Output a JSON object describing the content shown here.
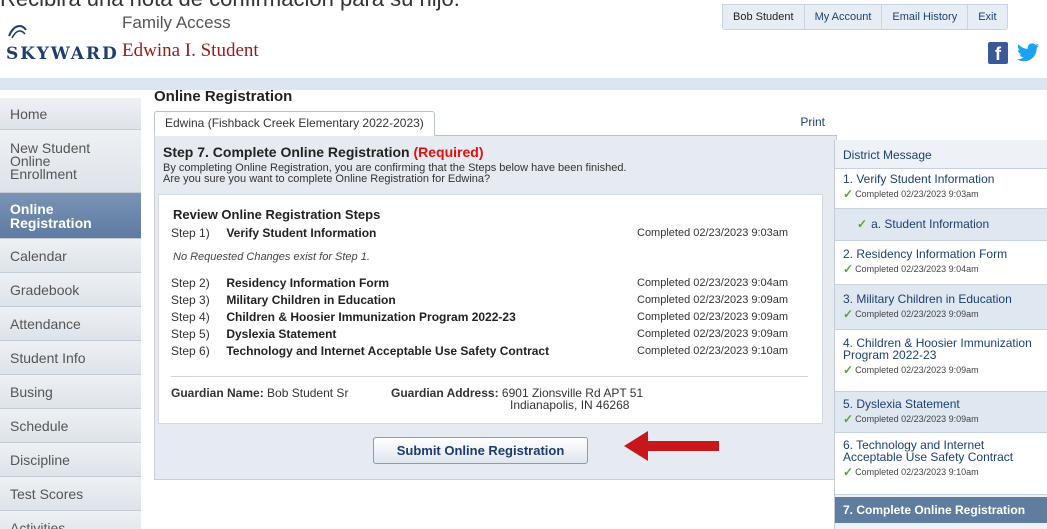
{
  "caption": "Recibirá una nota de confirmación para su hijo.",
  "header": {
    "logo_text": "SKYWARD",
    "app_name": "Family Access",
    "student_name": "Edwina I. Student",
    "topnav": [
      "Bob Student",
      "My Account",
      "Email History",
      "Exit"
    ],
    "social": {
      "facebook": "f",
      "twitter": "twitter-bird-icon"
    }
  },
  "sidebar": {
    "items": [
      {
        "label": "Home",
        "active": false
      },
      {
        "label": "New Student Online Enrollment",
        "active": false
      },
      {
        "label": "Online Registration",
        "active": true
      },
      {
        "label": "Calendar",
        "active": false
      },
      {
        "label": "Gradebook",
        "active": false
      },
      {
        "label": "Attendance",
        "active": false
      },
      {
        "label": "Student Info",
        "active": false
      },
      {
        "label": "Busing",
        "active": false
      },
      {
        "label": "Schedule",
        "active": false
      },
      {
        "label": "Discipline",
        "active": false
      },
      {
        "label": "Test Scores",
        "active": false
      },
      {
        "label": "Activities",
        "active": false
      }
    ]
  },
  "main": {
    "title": "Online Registration",
    "tab": "Edwina (Fishback Creek Elementary 2022-2023)",
    "print": "Print",
    "step_title": "Step 7. Complete Online Registration",
    "required": "(Required)",
    "desc_line1": "By completing Online Registration, you are confirming that the Steps below have been finished.",
    "desc_line2": "Are you sure you want to complete Online Registration for Edwina?",
    "review_title": "Review Online Registration Steps",
    "no_changes": "No Requested Changes exist for Step 1.",
    "steps": [
      {
        "num": "Step 1)",
        "name": "Verify Student Information",
        "done": "Completed 02/23/2023 9:03am"
      },
      {
        "num": "Step 2)",
        "name": "Residency Information Form",
        "done": "Completed 02/23/2023 9:04am"
      },
      {
        "num": "Step 3)",
        "name": "Military Children in Education",
        "done": "Completed 02/23/2023 9:09am"
      },
      {
        "num": "Step 4)",
        "name": "Children & Hoosier Immunization Program 2022-23",
        "done": "Completed 02/23/2023 9:09am"
      },
      {
        "num": "Step 5)",
        "name": "Dyslexia Statement",
        "done": "Completed 02/23/2023 9:09am"
      },
      {
        "num": "Step 6)",
        "name": "Technology and Internet Acceptable Use Safety Contract",
        "done": "Completed 02/23/2023 9:10am"
      }
    ],
    "guardian_name_label": "Guardian Name:",
    "guardian_name": "Bob Student Sr",
    "guardian_address_label": "Guardian Address:",
    "guardian_address_1": "6901 Zionsville Rd APT 51",
    "guardian_address_2": "Indianapolis, IN 46268",
    "submit_label": "Submit Online Registration"
  },
  "right_panel": {
    "title": "District Message",
    "items": [
      {
        "title": "1. Verify Student Information",
        "completed": "Completed 02/23/2023 9:03am"
      },
      {
        "sub": "a. Student Information"
      },
      {
        "title": "2. Residency Information Form",
        "completed": "Completed 02/23/2023 9:04am"
      },
      {
        "title": "3. Military Children in Education",
        "completed": "Completed 02/23/2023 9:09am"
      },
      {
        "title": "4. Children & Hoosier Immunization Program 2022-23",
        "completed": "Completed 02/23/2023 9:09am"
      },
      {
        "title": "5. Dyslexia Statement",
        "completed": "Completed 02/23/2023 9:09am"
      },
      {
        "title": "6. Technology and Internet Acceptable Use Safety Contract",
        "completed": "Completed 02/23/2023 9:10am"
      }
    ],
    "current": "7. Complete Online Registration"
  },
  "colors": {
    "accent": "#9b1b1b",
    "arrow": "#c8161d",
    "active_nav": "#5d7aa1",
    "required": "#dd1111"
  }
}
